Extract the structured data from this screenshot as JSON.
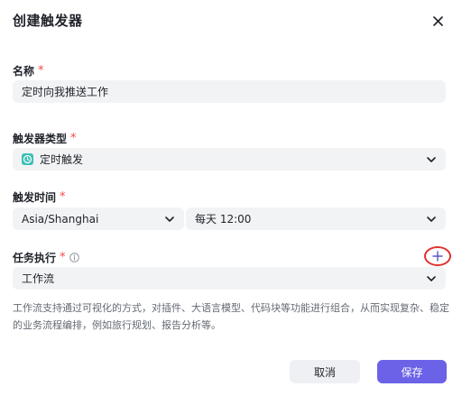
{
  "dialog": {
    "title": "创建触发器"
  },
  "name_field": {
    "label": "名称",
    "required_mark": "*",
    "value": "定时向我推送工作"
  },
  "trigger_type": {
    "label": "触发器类型",
    "required_mark": "*",
    "selected": "定时触发",
    "icon": "clock-icon",
    "icon_color": "#3bbfb5"
  },
  "trigger_time": {
    "label": "触发时间",
    "required_mark": "*",
    "timezone": "Asia/Shanghai",
    "schedule": "每天 12:00"
  },
  "task": {
    "label": "任务执行",
    "required_mark": "*",
    "selected": "工作流",
    "description": "工作流支持通过可视化的方式，对插件、大语言模型、代码块等功能进行组合，从而实现复杂、稳定的业务流程编排，例如旅行规划、报告分析等。"
  },
  "footer": {
    "cancel_label": "取消",
    "save_label": "保存"
  },
  "colors": {
    "primary": "#6b62e8",
    "required": "#f54a45",
    "highlight_circle": "#e03131",
    "field_bg": "#f2f3f5"
  }
}
